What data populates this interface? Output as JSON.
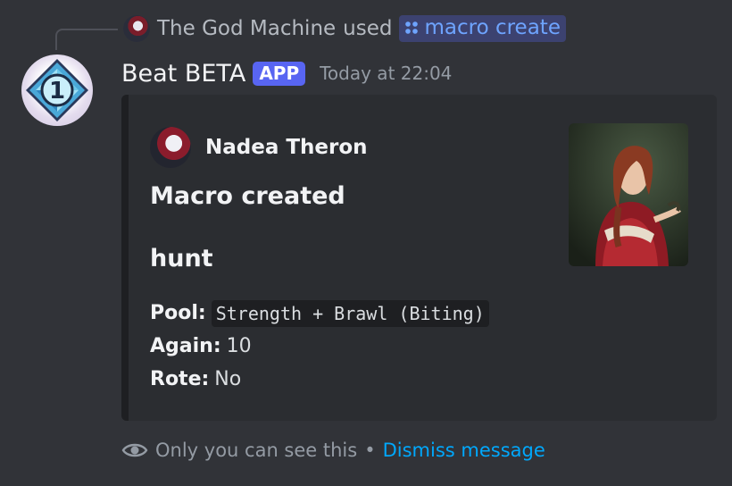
{
  "reply": {
    "user": "The God Machine",
    "verb": "used",
    "command": "macro create"
  },
  "message": {
    "bot_name": "Beat BETA",
    "badge": "APP",
    "timestamp": "Today at 22:04",
    "avatar_digit": "1"
  },
  "embed": {
    "author": "Nadea Theron",
    "title": "Macro created",
    "field_name": "hunt",
    "lines": [
      {
        "key": "Pool:",
        "value": "Strength + Brawl (Biting)"
      },
      {
        "key": "Again:",
        "value": "10"
      },
      {
        "key": "Rote:",
        "value": "No"
      }
    ]
  },
  "ephemeral": {
    "notice": "Only you can see this",
    "separator": "•",
    "dismiss": "Dismiss message"
  },
  "colors": {
    "background": "#313338",
    "embed_background": "#2b2d31",
    "app_badge": "#5865f2",
    "command_text": "#6ea4ff",
    "link": "#00a8fc"
  }
}
